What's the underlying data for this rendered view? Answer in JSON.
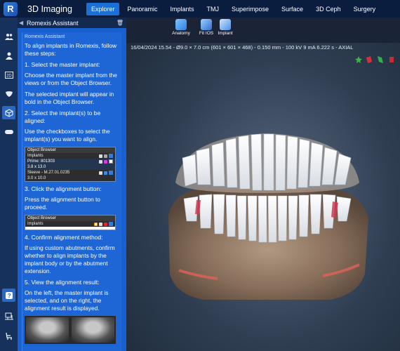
{
  "app": {
    "logo": "R",
    "title": "3D Imaging"
  },
  "tabs": [
    {
      "label": "Explorer",
      "active": true
    },
    {
      "label": "Panoramic",
      "active": false
    },
    {
      "label": "Implants",
      "active": false
    },
    {
      "label": "TMJ",
      "active": false
    },
    {
      "label": "Superimpose",
      "active": false
    },
    {
      "label": "Surface",
      "active": false
    },
    {
      "label": "3D Ceph",
      "active": false
    },
    {
      "label": "Surgery",
      "active": false
    }
  ],
  "panel": {
    "header_title": "Romexis Assistant",
    "subheader": "Romexis Assistant",
    "intro": "To align implants in Romexis, follow these steps:",
    "step1_title": "1. Select the master implant:",
    "step1_text": "Choose the master implant from the views or from the Object Browser.",
    "step1_note": "The selected implant will appear in bold in the Object Browser.",
    "step2_title": "2. Select the implant(s) to be aligned:",
    "step2_text": "Use the checkboxes to select the implant(s) you want to align.",
    "ob1": {
      "header": "Object Browser",
      "row_implants": "Implants",
      "row_prime": "Prime: 801303",
      "row_prime_size": "3.8 x 13.0",
      "row_sleeve": "Sleeve - M.27.01.0235",
      "row_sleeve_size": "3.0 x 10.0"
    },
    "step3_title": "3. Click the alignment button:",
    "step3_text": "Press the alignment button to proceed.",
    "ob2": {
      "header": "Object Browser",
      "row_implants": "Implants"
    },
    "step4_title": "4. Confirm alignment method:",
    "step4_text": "If using custom abutments, confirm whether to align implants by the implant body or by the abutment extension.",
    "step5_title": "5. View the alignment result:",
    "step5_text": "On the left, the master implant is selected, and on the right, the alignment result is displayed."
  },
  "viewport": {
    "tools": [
      {
        "label": "Anatomy"
      },
      {
        "label": "Fit IOS"
      },
      {
        "label": "Implant"
      }
    ],
    "info": "16/04/2024 15.54 - Ø9.0 × 7.0 cm (601 × 601 × 468) - 0.150 mm - 100 kV 9 mA 6.222 s - AXIAL"
  },
  "colors": {
    "accent": "#1c6fd6",
    "panel": "#1860d0",
    "topbar": "#0b1d3f"
  }
}
